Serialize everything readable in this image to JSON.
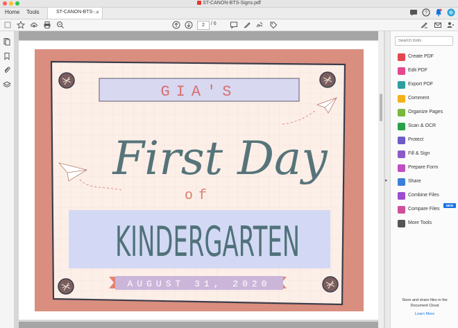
{
  "window": {
    "title": "ST-CANON-BTS-Signs.pdf",
    "traffic_colors": [
      "#fe5f57",
      "#febc2e",
      "#28c840"
    ]
  },
  "nav": {
    "home": "Home",
    "tools": "Tools",
    "doc_tab": "ST-CANON-BTS-...",
    "close": "×"
  },
  "header_icons": [
    "chat-icon",
    "help-icon",
    "notifications-icon",
    "profile-avatar"
  ],
  "toolbar": {
    "page_current": "2",
    "page_total": "/ 6",
    "left_icons": [
      "save-icon",
      "bookmark-star-icon",
      "upload-icon",
      "print-icon",
      "zoom-out-icon"
    ],
    "nav_icons": [
      "page-up-icon",
      "page-down-icon"
    ],
    "tool_icons": [
      "comment-icon",
      "highlight-icon",
      "sign-icon",
      "tag-icon"
    ],
    "right_icons": [
      "fill-sign-icon",
      "mail-icon",
      "share-user-icon"
    ]
  },
  "left_rail": [
    "pages-icon",
    "bookmarks-icon",
    "attachments-icon",
    "layers-icon"
  ],
  "document": {
    "name": "GIA'S",
    "first_day": "First Day",
    "of": "of",
    "grade": "KINDERGARTEN",
    "date": "AUGUST 31, 2020",
    "colors": {
      "border": "#d98e7f",
      "paper": "#fcefe8",
      "grid": "#f0d8d0",
      "outline": "#3c3c4a",
      "name_box": "#d8d8f1",
      "name_text": "#d96f6f",
      "script_text": "#56747a",
      "of_text": "#d97f6c",
      "grade_box": "#d3d9f4",
      "grade_text": "#50727a",
      "ribbon": "#cbb6da",
      "ribbon_tails": "#e4826f",
      "date_text": "#ffffff",
      "pin": "#7a5e5e"
    }
  },
  "tools_panel": {
    "search_placeholder": "Search tools",
    "items": [
      {
        "label": "Create PDF",
        "color": "#e34850"
      },
      {
        "label": "Edit PDF",
        "color": "#e34890"
      },
      {
        "label": "Export PDF",
        "color": "#2e9e9e"
      },
      {
        "label": "Comment",
        "color": "#f2b21b"
      },
      {
        "label": "Organize Pages",
        "color": "#78b83b"
      },
      {
        "label": "Scan & OCR",
        "color": "#2aa04a"
      },
      {
        "label": "Protect",
        "color": "#6e5ac8"
      },
      {
        "label": "Fill & Sign",
        "color": "#8c5ac8"
      },
      {
        "label": "Prepare Form",
        "color": "#c24fc2"
      },
      {
        "label": "Share",
        "color": "#3b7ed8"
      },
      {
        "label": "Combine Files",
        "color": "#9b4fd0"
      },
      {
        "label": "Compare Files",
        "color": "#d04f9b"
      },
      {
        "label": "More Tools",
        "color": "#555555"
      }
    ],
    "new_badge": "NEW",
    "promo_line1": "Store and share files in the",
    "promo_line2": "Document Cloud",
    "learn_more": "Learn More"
  }
}
